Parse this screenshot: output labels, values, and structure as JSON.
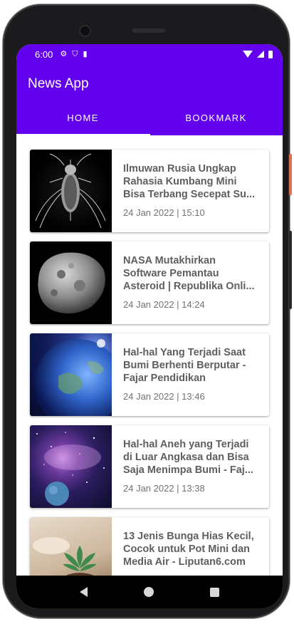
{
  "status_bar": {
    "time": "6:00"
  },
  "app_bar": {
    "title": "News App"
  },
  "tabs": [
    {
      "label": "HOME",
      "selected": true
    },
    {
      "label": "BOOKMARK",
      "selected": false
    }
  ],
  "news": [
    {
      "title": "Ilmuwan Rusia Ungkap Rahasia Kumbang Mini Bisa Terbang Secepat Su...",
      "date": "24 Jan 2022 | 15:10",
      "image": "beetle-photo"
    },
    {
      "title": "NASA Mutakhirkan Software Pemantau Asteroid | Republika Onli...",
      "date": "24 Jan 2022 | 14:24",
      "image": "asteroid-photo"
    },
    {
      "title": "Hal-hal Yang Terjadi Saat Bumi Berhenti Berputar - Fajar Pendidikan",
      "date": "24 Jan 2022 | 13:46",
      "image": "earth-photo"
    },
    {
      "title": "Hal-hal Aneh yang Terjadi di Luar Angkasa dan Bisa Saja Menimpa Bumi - Faj...",
      "date": "24 Jan 2022 | 13:38",
      "image": "space-photo"
    },
    {
      "title": "13 Jenis Bunga Hias Kecil, Cocok untuk Pot Mini dan Media Air - Liputan6.com",
      "date": "",
      "image": "plant-photo"
    }
  ],
  "colors": {
    "primary": "#6200ee",
    "status_bar": "#6300ee",
    "title_text": "#5f5f5f",
    "date_text": "#727272"
  }
}
